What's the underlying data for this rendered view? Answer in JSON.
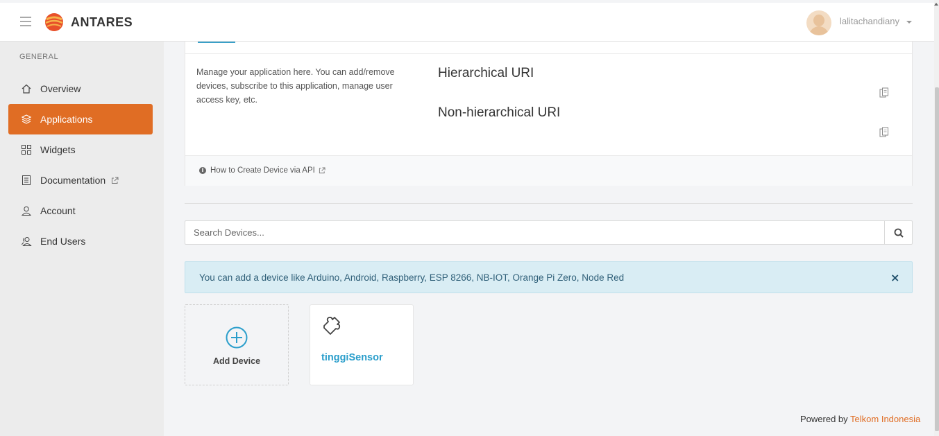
{
  "header": {
    "brand": "ANTARES",
    "username": "lalitachandiany"
  },
  "sidebar": {
    "heading": "GENERAL",
    "items": [
      {
        "label": "Overview",
        "icon": "home-icon"
      },
      {
        "label": "Applications",
        "icon": "layers-icon",
        "active": true
      },
      {
        "label": "Widgets",
        "icon": "grid-icon"
      },
      {
        "label": "Documentation",
        "icon": "book-icon",
        "external": true
      },
      {
        "label": "Account",
        "icon": "user-icon"
      },
      {
        "label": "End Users",
        "icon": "users-icon"
      }
    ]
  },
  "app_card": {
    "description": "Manage your application here. You can add/remove devices, subscribe to this application, manage user access key, etc.",
    "hierarchical_uri_label": "Hierarchical URI",
    "non_hierarchical_uri_label": "Non-hierarchical URI",
    "footer_link": "How to Create Device via API"
  },
  "search": {
    "placeholder": "Search Devices..."
  },
  "alert": {
    "message": "You can add a device like Arduino, Android, Raspberry, ESP 8266, NB-IOT, Orange Pi Zero, Node Red",
    "close": "×"
  },
  "devices": {
    "add_label": "Add Device",
    "items": [
      {
        "name": "tinggiSensor",
        "icon": "puzzle-icon"
      }
    ]
  },
  "footer": {
    "prefix": "Powered by",
    "link": "Telkom Indonesia"
  },
  "colors": {
    "accent": "#e06d24",
    "link": "#2a9ecb",
    "alert_bg": "#d9edf4"
  }
}
